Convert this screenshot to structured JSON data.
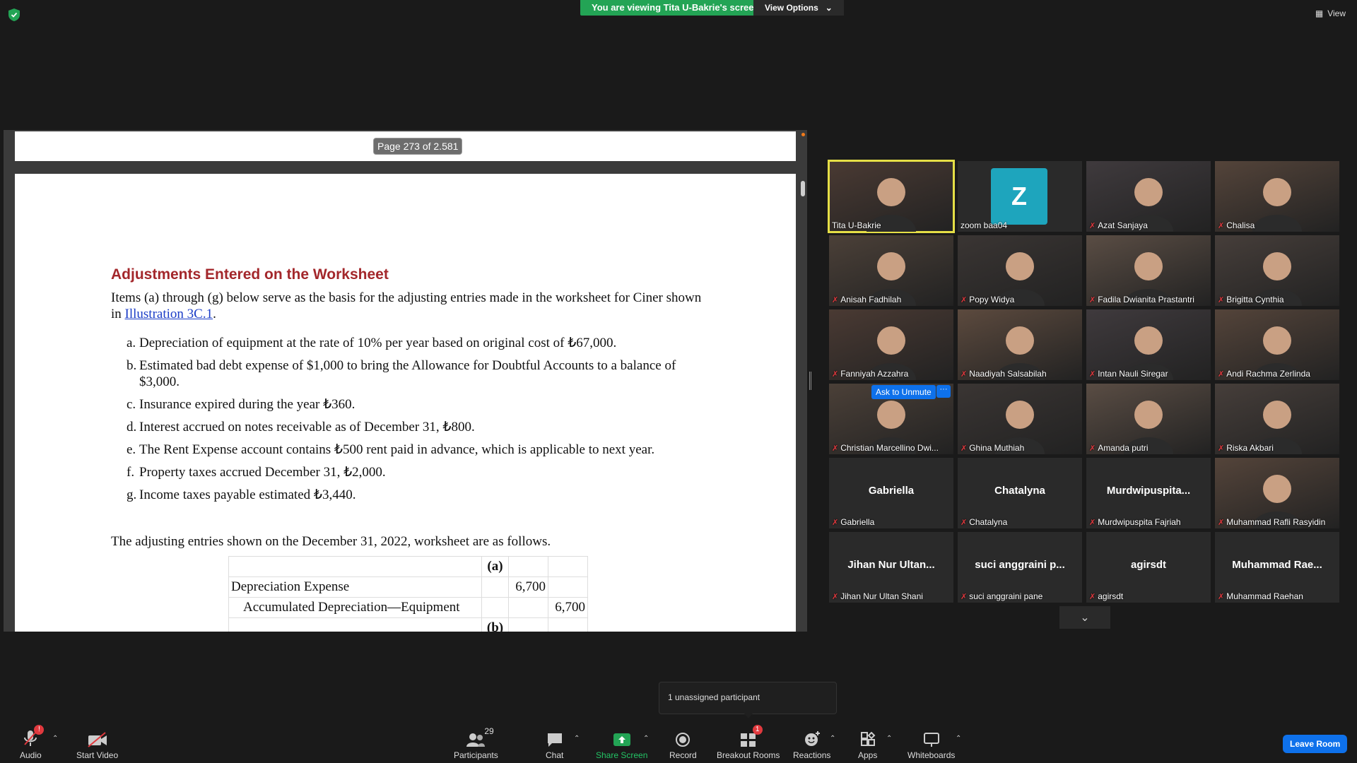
{
  "top": {
    "viewing_text": "You are viewing Tita U-Bakrie's screen",
    "view_options": "View Options",
    "view_label": "View"
  },
  "pdf": {
    "page_indicator": "Page 273 of 2.581",
    "heading": "Adjustments Entered on the Worksheet",
    "intro_prefix": "Items (a) through (g) below serve as the basis for the adjusting entries made in the worksheet for Ciner shown in ",
    "intro_link": "Illustration 3C.1",
    "intro_suffix": ".",
    "items": [
      {
        "letter": "a.",
        "text": "Depreciation of equipment at the rate of 10% per year based on original cost of ₺67,000."
      },
      {
        "letter": "b.",
        "text": "Estimated bad debt expense of $1,000 to bring the Allowance for Doubtful Accounts to a balance of $3,000."
      },
      {
        "letter": "c.",
        "text": "Insurance expired during the year ₺360."
      },
      {
        "letter": "d.",
        "text": "Interest accrued on notes receivable as of December 31, ₺800."
      },
      {
        "letter": "e.",
        "text": "The Rent Expense account contains ₺500 rent paid in advance, which is applicable to next year."
      },
      {
        "letter": "f.",
        "text": "Property taxes accrued December 31, ₺2,000."
      },
      {
        "letter": "g.",
        "text": "Income taxes payable estimated ₺3,440."
      }
    ],
    "closing": "The adjusting entries shown on the December 31, 2022, worksheet are as follows.",
    "table": {
      "marker_a": "(a)",
      "row1_account": "Depreciation Expense",
      "row1_debit": "6,700",
      "row2_account": "Accumulated Depreciation—Equipment",
      "row2_credit": "6,700",
      "marker_b": "(b)"
    }
  },
  "participants_gallery": [
    {
      "name": "Tita U-Bakrie",
      "type": "video",
      "active": true
    },
    {
      "name": "zoom baa04",
      "type": "avatar",
      "initial": "Z"
    },
    {
      "name": "Azat Sanjaya",
      "type": "video"
    },
    {
      "name": "Chalisa",
      "type": "video"
    },
    {
      "name": "Anisah Fadhilah",
      "type": "video"
    },
    {
      "name": "Popy Widya",
      "type": "video"
    },
    {
      "name": "Fadila Dwianita Prastantri",
      "type": "video"
    },
    {
      "name": "Brigitta Cynthia",
      "type": "video"
    },
    {
      "name": "Fanniyah Azzahra",
      "type": "video"
    },
    {
      "name": "Naadiyah Salsabilah",
      "type": "video"
    },
    {
      "name": "Intan Nauli Siregar",
      "type": "video"
    },
    {
      "name": "Andi Rachma Zerlinda",
      "type": "video"
    },
    {
      "name": "Christian Marcellino Dwi...",
      "type": "video",
      "hover": true
    },
    {
      "name": "Ghina Muthiah",
      "type": "video"
    },
    {
      "name": "Amanda putri",
      "type": "video"
    },
    {
      "name": "Riska Akbari",
      "type": "video"
    },
    {
      "name": "Gabriella",
      "type": "name",
      "display": "Gabriella"
    },
    {
      "name": "Chatalyna",
      "type": "name",
      "display": "Chatalyna"
    },
    {
      "name": "Murdwipuspita Fajriah",
      "type": "name",
      "display": "Murdwipuspita..."
    },
    {
      "name": "Muhammad Rafli Rasyidin",
      "type": "video"
    },
    {
      "name": "Jihan Nur Ultan Shani",
      "type": "name",
      "display": "Jihan Nur Ultan..."
    },
    {
      "name": "suci anggraini pane",
      "type": "name",
      "display": "suci anggraini p..."
    },
    {
      "name": "agirsdt",
      "type": "name",
      "display": "agirsdt"
    },
    {
      "name": "Muhammad Raehan",
      "type": "name",
      "display": "Muhammad Rae..."
    }
  ],
  "hover_controls": {
    "ask_to_unmute": "Ask to Unmute",
    "more": "···"
  },
  "notice": "1 unassigned participant",
  "toolbar": {
    "audio": "Audio",
    "start_video": "Start Video",
    "participants": "Participants",
    "participants_count": "29",
    "chat": "Chat",
    "share_screen": "Share Screen",
    "record": "Record",
    "breakout_rooms": "Breakout Rooms",
    "breakout_badge": "1",
    "audio_badge": "!",
    "reactions": "Reactions",
    "apps": "Apps",
    "whiteboards": "Whiteboards",
    "leave_room": "Leave Room"
  },
  "colors": {
    "viewing_banner": "#23a455",
    "heading_red": "#a3272b",
    "active_speaker": "#e5df46",
    "zoom_blue": "#0e71eb",
    "avatar_teal": "#1ea5bd"
  }
}
